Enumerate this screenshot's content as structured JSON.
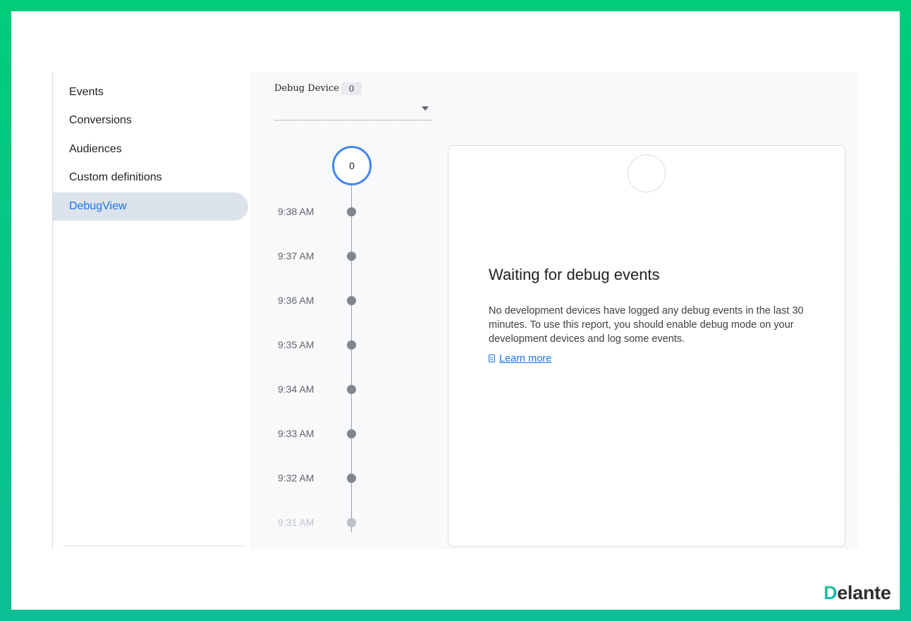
{
  "sidebar": {
    "items": [
      {
        "label": "Events",
        "active": false
      },
      {
        "label": "Conversions",
        "active": false
      },
      {
        "label": "Audiences",
        "active": false
      },
      {
        "label": "Custom definitions",
        "active": false
      },
      {
        "label": "DebugView",
        "active": true
      }
    ]
  },
  "device": {
    "label": "Debug Device",
    "count": "0"
  },
  "timeline": {
    "counter": "0",
    "times": [
      "9:38 AM",
      "9:37 AM",
      "9:36 AM",
      "9:35 AM",
      "9:34 AM",
      "9:33 AM",
      "9:32 AM",
      "9:31 AM"
    ]
  },
  "card": {
    "title": "Waiting for debug events",
    "body": "No development devices have logged any debug events in the last 30 minutes. To use this report, you should enable debug mode on your development devices and log some events.",
    "link": "Learn more"
  },
  "logo": {
    "first_letter": "D",
    "rest": "elante"
  },
  "colors": {
    "frame_gradient_top": "#00cc7a",
    "frame_gradient_bottom": "#0bbf95",
    "accent": "#1a73e8",
    "active_nav_bg": "#dde3ec",
    "counter_ring": "#4285f4"
  }
}
